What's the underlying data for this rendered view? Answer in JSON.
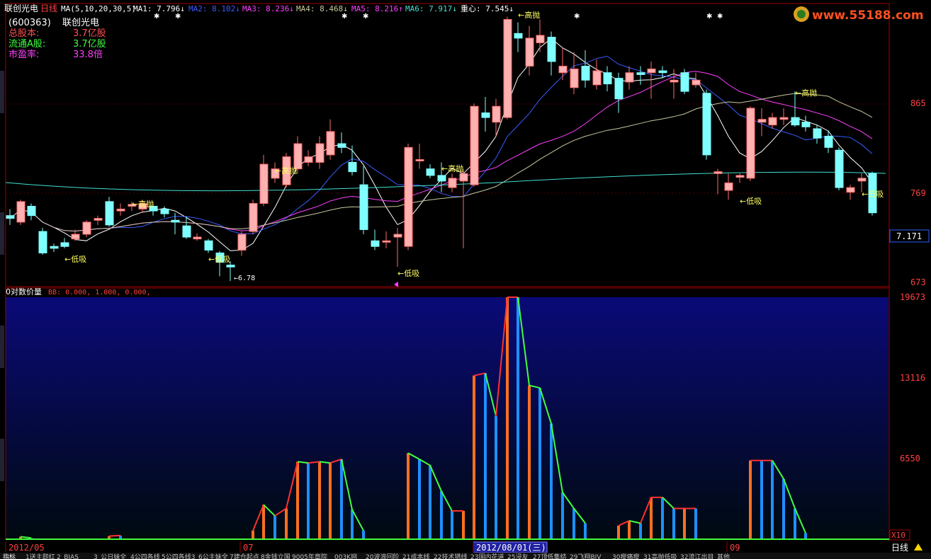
{
  "header": {
    "name": "联创光电",
    "period": "日线",
    "ma_params": "MA(5,10,20,30,5)",
    "ma": [
      {
        "label": "MA1:",
        "value": "7.796",
        "arrow": "↓",
        "color": "#ffffff"
      },
      {
        "label": "MA2:",
        "value": "8.102",
        "arrow": "↓",
        "color": "#3a5bff"
      },
      {
        "label": "MA3:",
        "value": "8.236",
        "arrow": "↓",
        "color": "#ff40ff"
      },
      {
        "label": "MA4:",
        "value": "8.468",
        "arrow": "↓",
        "color": "#c8c8a0"
      },
      {
        "label": "MA5:",
        "value": "8.216",
        "arrow": "↑",
        "color": "#ff40ff"
      },
      {
        "label": "MA6:",
        "value": "7.917",
        "arrow": "↓",
        "color": "#40e0d0"
      },
      {
        "label": "重心:",
        "value": "7.545",
        "arrow": "↓",
        "color": "#ffffff"
      }
    ]
  },
  "info": {
    "code": "(600363)",
    "name": "联创光电",
    "rows": [
      {
        "label": "总股本:",
        "value": "3.7亿股",
        "color": "#ff5050"
      },
      {
        "label": "流通A股:",
        "value": "3.7亿股",
        "color": "#40ff40"
      },
      {
        "label": "市盈率:",
        "value": "33.8倍",
        "color": "#ff40ff"
      }
    ]
  },
  "logo": {
    "text": "www.55188.com"
  },
  "chart_data": [
    {
      "type": "candlestick",
      "y_ticks": [
        "865",
        "769",
        "673"
      ],
      "current_price": "7.171",
      "annotations": {
        "high": "高抛",
        "low": "低吸",
        "low_price": "6.78"
      },
      "series": [
        {
          "name": "MA1",
          "color": "#ffffff"
        },
        {
          "name": "MA2",
          "color": "#3a5bff"
        },
        {
          "name": "MA3",
          "color": "#ff40ff"
        },
        {
          "name": "MA4",
          "color": "#c8c8a0"
        },
        {
          "name": "MA6",
          "color": "#40e0d0"
        }
      ]
    },
    {
      "type": "bar",
      "title": "0对数价量",
      "legend": "BB: 0.000, 1.000, 0.000,",
      "y_ticks": [
        "19673",
        "13116",
        "6550"
      ],
      "multiplier": "X10",
      "colors": {
        "up": "#ff7020",
        "down": "#1e90ff",
        "line_up": "#ff3030",
        "line_down": "#40ff40"
      }
    }
  ],
  "x_axis": {
    "labels": [
      "2012/05",
      "07",
      "2012/08/01(三)",
      "09"
    ]
  },
  "bottom_bar": {
    "tab": "指标",
    "period": "日线",
    "items": [
      "1送主即红",
      "2_BIAS",
      "3_公日妹全",
      "4公四各线",
      "5公四各线3",
      "6公主妹全",
      "7建仓起点",
      "8金钱立国",
      "9005年章院",
      "003K网",
      "20波浪回阶",
      "21成本线",
      "22技术猎线",
      "23国内花道",
      "25浸友",
      "27顶低集结",
      "29飞翔BIV",
      "30瘦痛瘦",
      "31高抛低吸",
      "32流江出目",
      "其他"
    ]
  }
}
